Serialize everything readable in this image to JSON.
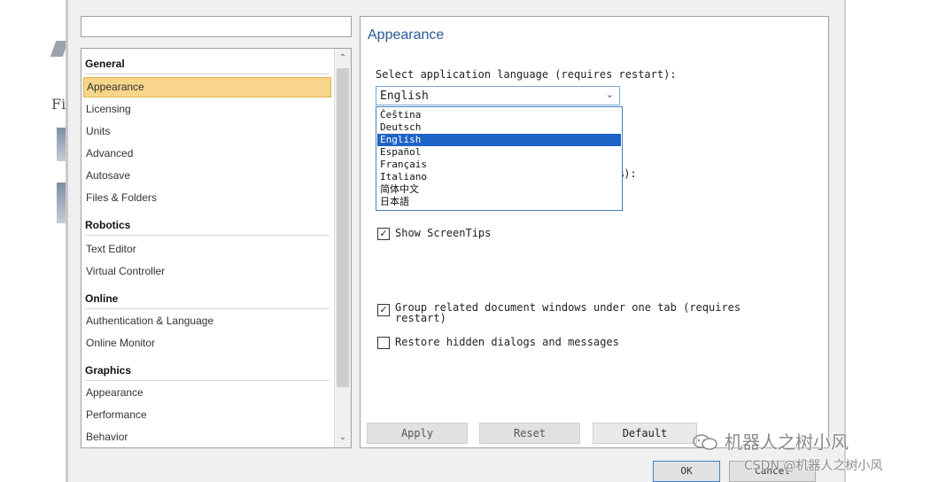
{
  "background_window": {
    "partial_text": "Fi"
  },
  "sidebar": {
    "search_value": "",
    "groups": [
      {
        "title": "General",
        "items": [
          "Appearance",
          "Licensing",
          "Units",
          "Advanced",
          "Autosave",
          "Files & Folders"
        ]
      },
      {
        "title": "Robotics",
        "items": [
          "Text Editor",
          "Virtual Controller"
        ]
      },
      {
        "title": "Online",
        "items": [
          "Authentication & Language",
          "Online Monitor"
        ]
      },
      {
        "title": "Graphics",
        "items": [
          "Appearance",
          "Performance",
          "Behavior"
        ]
      }
    ],
    "selected": "General / Appearance"
  },
  "content": {
    "heading": "Appearance",
    "language_label": "Select application language (requires restart):",
    "language_selected": "English",
    "language_options": [
      "Čeština",
      "Deutsch",
      "English",
      "Español",
      "Français",
      "Italiano",
      "简体中文",
      "日本語"
    ],
    "hidden_label_fragment": "%):",
    "checkboxes": [
      {
        "label": "Show ScreenTips",
        "checked": true
      },
      {
        "label_line1": "Group related document windows under one tab (requires",
        "label_line2": "restart)",
        "checked": true
      },
      {
        "label": "Restore hidden dialogs and messages",
        "checked": false
      }
    ],
    "buttons": {
      "apply": "Apply",
      "reset": "Reset",
      "default": "Default"
    }
  },
  "dialog_buttons": {
    "ok": "OK",
    "cancel": "Cancel"
  },
  "watermark": {
    "line1": "机器人之树小风",
    "line2": "CSDN @机器人之树小风"
  },
  "colors": {
    "selection_highlight": "#f7d58a",
    "dropdown_selected": "#1e63c6",
    "heading": "#2b579a"
  }
}
